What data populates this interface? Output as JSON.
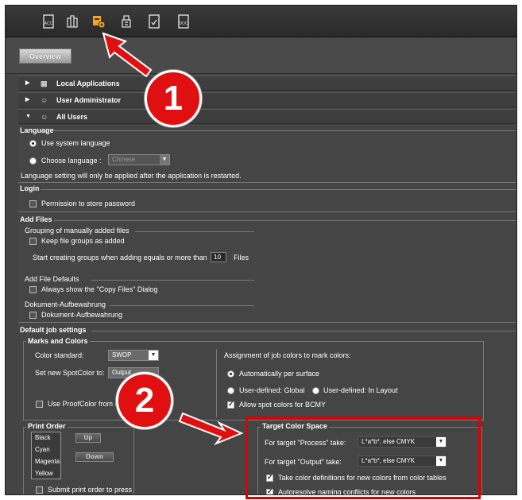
{
  "toolbar": {
    "icons": [
      "acc-icon",
      "frame-icon",
      "user-settings-icon",
      "printer-icon",
      "check-file-icon",
      "doc-icon"
    ]
  },
  "overview_tab": "Overview",
  "sections": {
    "local_apps": "Local Applications",
    "user_admin": "User Administrator",
    "all_users": "All Users"
  },
  "language": {
    "header": "Language",
    "use_system": "Use system language",
    "choose": "Choose language :",
    "choose_value": "Chinese",
    "note": "Language setting will only be applied after the application is restarted."
  },
  "login": {
    "header": "Login",
    "permission": "Permission to store password"
  },
  "add_files": {
    "header": "Add Files",
    "grouping": "Grouping of manually added files",
    "keep_groups": "Keep file groups as added",
    "start_groups": "Start creating groups when adding equals or more than",
    "count": "10",
    "files": "Files",
    "defaults": "Add File Defaults",
    "always_show": "Always show the \"Copy Files\" Dialog",
    "dokument": "Dokument-Aufbewahrung",
    "dokument_cb": "Dokument-Aufbewahrung"
  },
  "job": {
    "header": "Default job settings",
    "marks": "Marks and Colors",
    "color_standard": "Color standard:",
    "color_standard_value": "SWOP",
    "spotcolor": "Set new SpotColor to:",
    "spotcolor_value": "Output",
    "proofcolor": "Use ProofColor from P",
    "assignment": "Assignment of job colors to mark colors:",
    "auto": "Automatically per surface",
    "user_global": "User-defined: Global",
    "user_layout": "User-defined: In Layout",
    "allow_spot": "Allow spot colors for BCMY",
    "print_order": "Print Order",
    "colors": [
      "Black",
      "Cyan",
      "Magenta",
      "Yellow"
    ],
    "up": "Up",
    "down": "Down",
    "submit": "Submit print order to press",
    "target": "Target Color Space",
    "process_label": "For target \"Process\" take:",
    "process_value": "L*a*b*, else CMYK",
    "output_label": "For target \"Output\" take:",
    "output_value": "L*a*b*, else CMYK",
    "take_defs": "Take color definitions for new colors from color tables",
    "autoresolve": "Autoresolve naming conflicts for new colors"
  },
  "callouts": [
    "1",
    "2"
  ],
  "colors": {
    "highlight": "#e00000",
    "accent": "#f5a623"
  }
}
